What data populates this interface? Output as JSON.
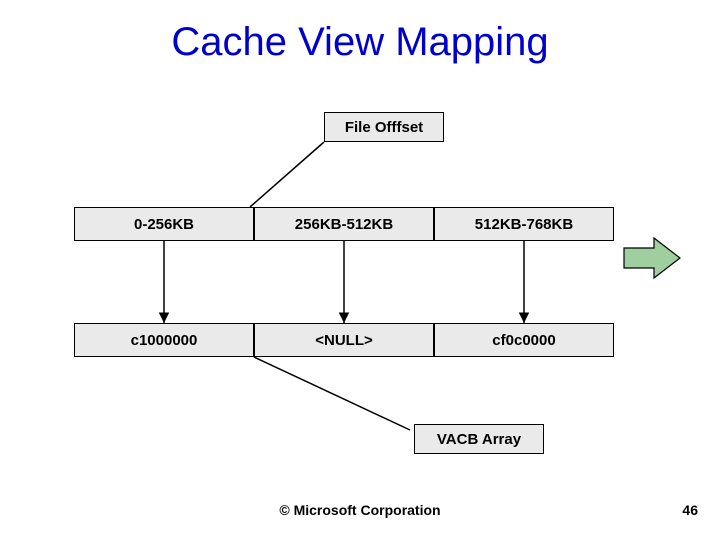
{
  "title": "Cache View Mapping",
  "file_offset_label": "File Offfset",
  "offsets": {
    "col0": "0-256KB",
    "col1": "256KB-512KB",
    "col2": "512KB-768KB"
  },
  "vacb": {
    "col0": "c1000000",
    "col1": "<NULL>",
    "col2": "cf0c0000"
  },
  "vacb_label": "VACB Array",
  "footer": "© Microsoft Corporation",
  "page_number": "46"
}
